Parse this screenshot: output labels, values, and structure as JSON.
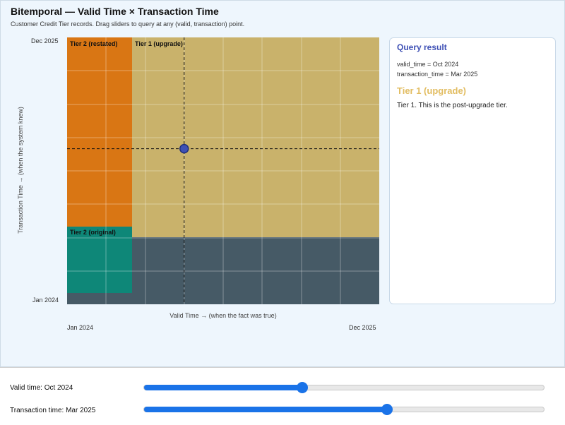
{
  "header": {
    "title": "Bitemporal — Valid Time × Transaction Time",
    "subtitle": "Customer Credit Tier records. Drag sliders to query at any (valid, transaction) point."
  },
  "axes": {
    "y_label": "Transaction Time → (when the system knew)",
    "y_top": "Dec 2025",
    "y_bottom": "Jan 2024",
    "x_label": "Valid Time → (when the fact was true)",
    "x_left": "Jan 2024",
    "x_right": "Dec 2025"
  },
  "regions": [
    {
      "label": "Tier 2 (restated)",
      "color": "#d97614"
    },
    {
      "label": "Tier 1 (upgrade)",
      "color": "#c9b26b"
    },
    {
      "label": "Tier 2 (original)",
      "color": "#0e8778"
    }
  ],
  "colors": {
    "background_region": "#465a66",
    "query_point": "#3f51b5",
    "accent": "#1a73e8",
    "result_tier": "#e2bd62"
  },
  "query": {
    "valid_fraction": 0.375,
    "transaction_fraction": 0.583
  },
  "result": {
    "title": "Query result",
    "valid_line": "valid_time = Oct 2024",
    "transaction_line": "transaction_time = Mar 2025",
    "tier_name": "Tier 1 (upgrade)",
    "description": "Tier 1. This is the post-upgrade tier."
  },
  "controls": {
    "valid_label": "Valid time: Oct 2024",
    "valid_value": 0.395,
    "transaction_label": "Transaction time: Mar 2025",
    "transaction_value": 0.606
  }
}
